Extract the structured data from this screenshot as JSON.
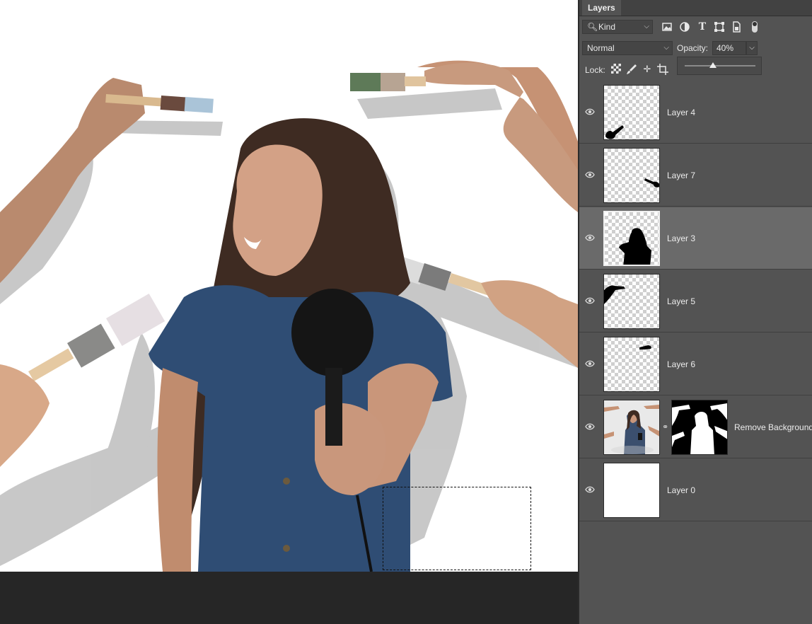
{
  "layers_panel": {
    "tab_title": "Layers",
    "filter_kind": "Kind",
    "filter_icons": [
      "image-filter-icon",
      "adjustment-filter-icon",
      "type-filter-icon",
      "shape-filter-icon",
      "smart-object-filter-icon"
    ],
    "blend_mode": "Normal",
    "opacity_label": "Opacity:",
    "opacity_value": "40%",
    "opacity_slider_fraction": 0.4,
    "lock_label": "Lock:",
    "lock_icons": [
      "lock-transparency-icon",
      "lock-paint-icon",
      "lock-position-icon",
      "lock-artboard-icon"
    ],
    "layers": [
      {
        "name": "Layer 4",
        "visible": true,
        "selected": false
      },
      {
        "name": "Layer 7",
        "visible": true,
        "selected": false
      },
      {
        "name": "Layer 3",
        "visible": true,
        "selected": true
      },
      {
        "name": "Layer 5",
        "visible": true,
        "selected": false
      },
      {
        "name": "Layer 6",
        "visible": true,
        "selected": false
      },
      {
        "name": "Remove Background",
        "visible": true,
        "selected": false,
        "has_mask": true
      },
      {
        "name": "Layer 0",
        "visible": true,
        "selected": false
      }
    ]
  },
  "colors": {
    "panel_bg": "#535353",
    "selected_row": "#6a6a6a",
    "canvas_bg": "#ffffff",
    "workspace_bg": "#262626"
  }
}
